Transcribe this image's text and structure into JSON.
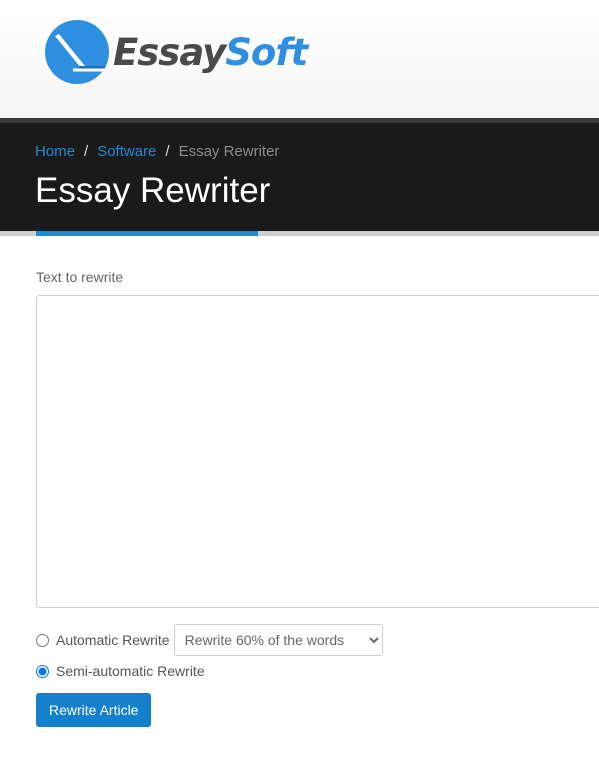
{
  "brand": {
    "part1": "Essay",
    "part2": "Soft"
  },
  "colors": {
    "accent": "#1a8bd8",
    "dark_band": "#1a1a1a",
    "button": "#1580cc"
  },
  "icons": {
    "logo": "pencil-icon"
  },
  "breadcrumb": {
    "home": "Home",
    "software": "Software",
    "current": "Essay Rewriter",
    "separator": "/"
  },
  "page": {
    "title": "Essay Rewriter"
  },
  "form": {
    "text_label": "Text to rewrite",
    "text_value": "",
    "auto_label": "Automatic Rewrite",
    "auto_checked": false,
    "select_value": "Rewrite 60% of the words",
    "semi_label": "Semi-automatic Rewrite",
    "semi_checked": true,
    "button_label": "Rewrite Article"
  }
}
